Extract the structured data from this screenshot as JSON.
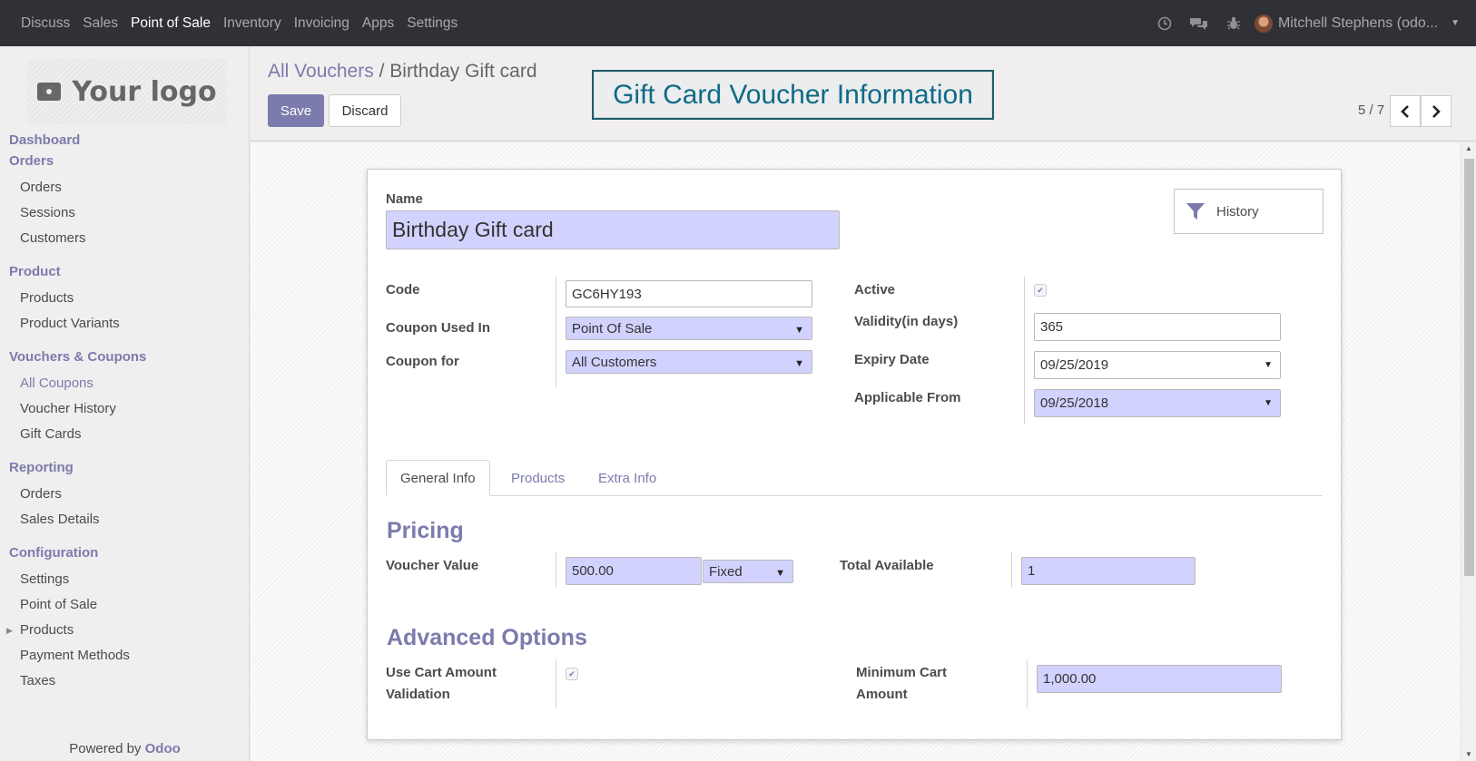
{
  "topbar": {
    "menu": [
      "Discuss",
      "Sales",
      "Point of Sale",
      "Inventory",
      "Invoicing",
      "Apps",
      "Settings"
    ],
    "active_menu": "Point of Sale",
    "icons": [
      "clock-icon",
      "chat-icon",
      "bug-icon"
    ],
    "user_name": "Mitchell Stephens (odo..."
  },
  "sidebar": {
    "logo_text": "Your logo",
    "sections": [
      {
        "title": "Dashboard",
        "items": []
      },
      {
        "title": "Orders",
        "items": [
          "Orders",
          "Sessions",
          "Customers"
        ]
      },
      {
        "title": "Product",
        "items": [
          "Products",
          "Product Variants"
        ]
      },
      {
        "title": "Vouchers & Coupons",
        "items": [
          "All Coupons",
          "Voucher History",
          "Gift Cards"
        ]
      },
      {
        "title": "Reporting",
        "items": [
          "Orders",
          "Sales Details"
        ]
      },
      {
        "title": "Configuration",
        "items": [
          "Settings",
          "Point of Sale",
          "Products",
          "Payment Methods",
          "Taxes"
        ]
      }
    ],
    "selected_item": "All Coupons",
    "powered_prefix": "Powered by",
    "powered_brand": "Odoo"
  },
  "control": {
    "breadcrumb_parent": "All Vouchers",
    "breadcrumb_sep": "/",
    "breadcrumb_current": "Birthday Gift card",
    "save_label": "Save",
    "discard_label": "Discard",
    "callout": "Gift Card Voucher Information",
    "pager": "5 / 7"
  },
  "form": {
    "name_label": "Name",
    "name_value": "Birthday Gift card",
    "history_label": "History",
    "code_label": "Code",
    "code_value": "GC6HY193",
    "used_in_label": "Coupon Used In",
    "used_in_value": "Point Of Sale",
    "coupon_for_label": "Coupon for",
    "coupon_for_value": "All Customers",
    "active_label": "Active",
    "validity_label": "Validity(in days)",
    "validity_value": "365",
    "expiry_label": "Expiry Date",
    "expiry_value": "09/25/2019",
    "applicable_label": "Applicable From",
    "applicable_value": "09/25/2018",
    "tabs": [
      "General Info",
      "Products",
      "Extra Info"
    ],
    "active_tab": "General Info",
    "pricing_title": "Pricing",
    "voucher_value_label": "Voucher Value",
    "voucher_value": "500.00",
    "voucher_type": "Fixed",
    "total_available_label": "Total Available",
    "total_available_value": "1",
    "advanced_title": "Advanced Options",
    "cart_validation_label_1": "Use Cart Amount",
    "cart_validation_label_2": "Validation",
    "min_cart_label_1": "Minimum Cart",
    "min_cart_label_2": "Amount",
    "min_cart_value": "1,000.00"
  }
}
